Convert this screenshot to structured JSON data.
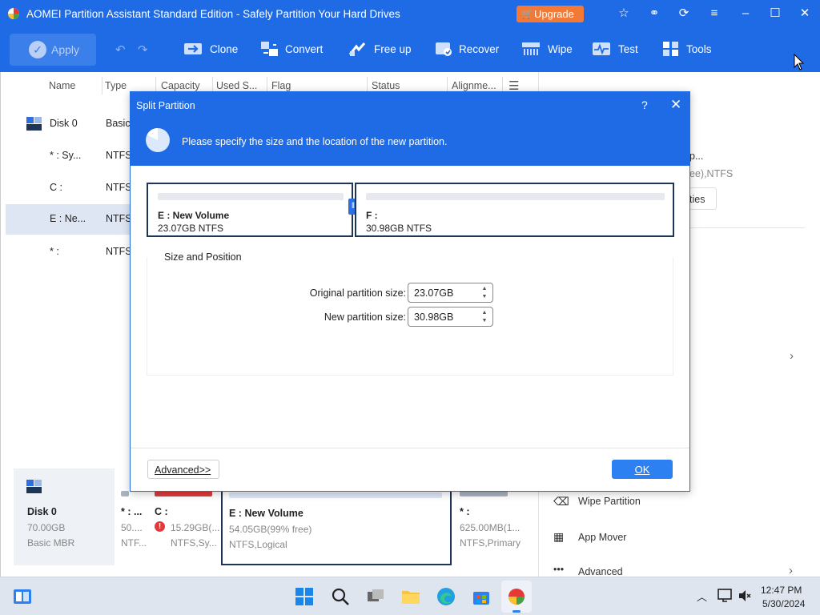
{
  "window": {
    "title": "AOMEI Partition Assistant Standard Edition - Safely Partition Your Hard Drives",
    "upgrade_label": "Upgrade"
  },
  "toolbar": {
    "apply_label": "Apply",
    "items": [
      {
        "label": "Clone",
        "icon": "clone-icon"
      },
      {
        "label": "Convert",
        "icon": "convert-icon"
      },
      {
        "label": "Free up",
        "icon": "free-up-icon"
      },
      {
        "label": "Recover",
        "icon": "recover-icon"
      },
      {
        "label": "Wipe",
        "icon": "wipe-icon"
      },
      {
        "label": "Test",
        "icon": "test-icon"
      },
      {
        "label": "Tools",
        "icon": "tools-icon"
      }
    ]
  },
  "table": {
    "columns": [
      "Name",
      "Type",
      "Capacity",
      "Used S...",
      "Flag",
      "Status",
      "Alignme..."
    ],
    "rows": [
      {
        "name": "Disk 0",
        "type": "Basic"
      },
      {
        "name": "* : Sy...",
        "type": "NTFS"
      },
      {
        "name": "C :",
        "type": "NTFS"
      },
      {
        "name": "E : Ne...",
        "type": "NTFS"
      },
      {
        "name": "* :",
        "type": "NTFS"
      }
    ]
  },
  "right_panel": {
    "partial_name": "p...",
    "partial_fs": "ee),NTFS",
    "properties_partial": "ties",
    "actions": [
      "Wipe Partition",
      "App Mover",
      "Advanced"
    ]
  },
  "disk_map": {
    "disk": {
      "name": "Disk 0",
      "size": "70.00GB",
      "type": "Basic MBR"
    },
    "partitions": [
      {
        "name": "* : ...",
        "line2": "50....",
        "line3": "NTF...",
        "color": "#a9b4c2"
      },
      {
        "name": "C :",
        "line2": "15.29GB(...",
        "line3": "NTFS,Sy...",
        "color": "#e03a3a"
      },
      {
        "name": "E : New Volume",
        "line2": "54.05GB(99% free)",
        "line3": "NTFS,Logical",
        "color": "#dbe6f7"
      },
      {
        "name": "* :",
        "line2": "625.00MB(1...",
        "line3": "NTFS,Primary",
        "color": "#a9b4c2"
      }
    ]
  },
  "dialog": {
    "title": "Split Partition",
    "instruction": "Please specify the size and the location of the new partition.",
    "left_partition": {
      "name": "E : New Volume",
      "size": "23.07GB NTFS"
    },
    "right_partition": {
      "name": "F :",
      "size": "30.98GB NTFS"
    },
    "group_title": "Size and Position",
    "original_label": "Original partition size:",
    "original_value": "23.07GB",
    "new_label": "New partition size:",
    "new_value": "30.98GB",
    "advanced_label": "Advanced>>",
    "ok_label": "OK"
  },
  "taskbar": {
    "time": "12:47 PM",
    "date": "5/30/2024"
  },
  "colors": {
    "brand_blue": "#1f6be6",
    "upgrade_orange": "#f37a36",
    "ok_blue": "#2d80f2",
    "selection": "#dfe6f3"
  }
}
